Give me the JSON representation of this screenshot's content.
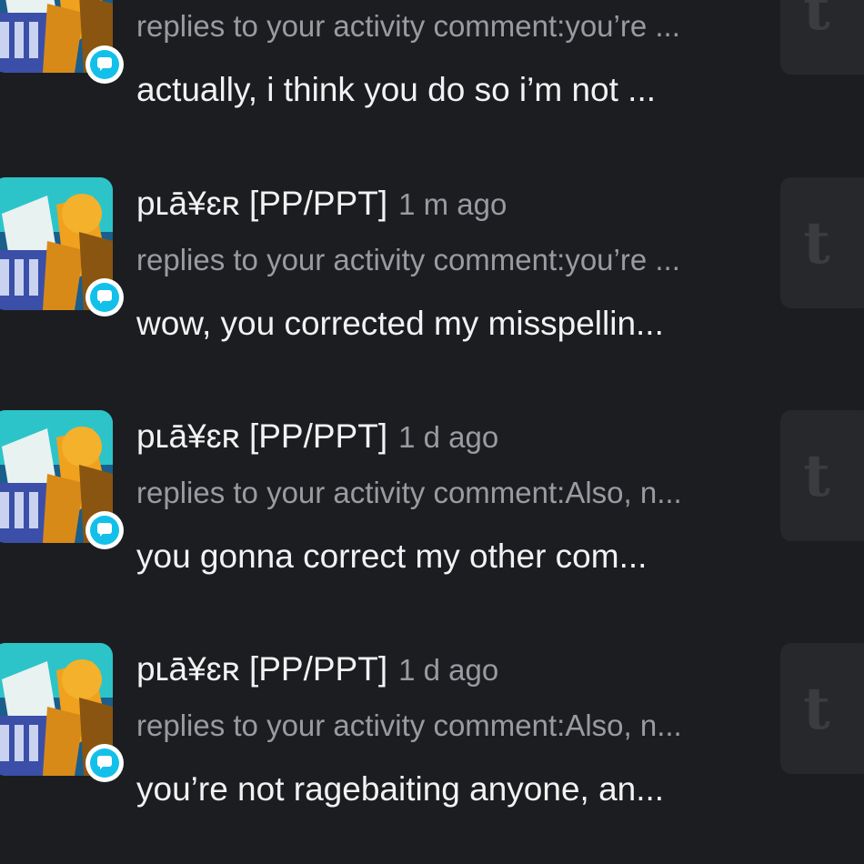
{
  "notifications": [
    {
      "username": "",
      "time": "",
      "activity": "replies to your activity comment:you’re ...",
      "message": "actually, i think you do so i’m not ..."
    },
    {
      "username": "pʟā̄¥ɛʀ [PP/PPT]",
      "time": "1 m ago",
      "activity": "replies to your activity comment:you’re ...",
      "message": "wow, you corrected my misspellin..."
    },
    {
      "username": "pʟā̄¥ɛʀ [PP/PPT]",
      "time": "1 d ago",
      "activity": "replies to your activity comment:Also, n...",
      "message": "you gonna correct my other com..."
    },
    {
      "username": "pʟā̄¥ɛʀ [PP/PPT]",
      "time": "1 d ago",
      "activity": "replies to your activity comment:Also, n...",
      "message": "you’re not ragebaiting anyone, an..."
    }
  ],
  "thumbnail_glyph": "t",
  "colors": {
    "background": "#1c1d21",
    "badge": "#13c0ea",
    "primary_text": "#f2f2f2",
    "secondary_text": "#9a9ba0",
    "thumbnail_bg": "#27282c"
  }
}
